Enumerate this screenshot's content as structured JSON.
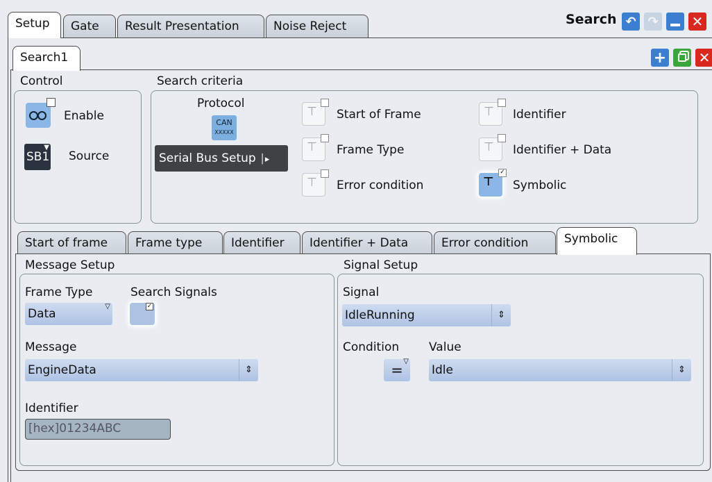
{
  "top_tabs": [
    "Setup",
    "Gate",
    "Result Presentation",
    "Noise Reject"
  ],
  "window": {
    "title": "Search"
  },
  "search_tab": "Search1",
  "control": {
    "title": "Control",
    "enable_label": "Enable",
    "source_badge": "SB1",
    "source_label": "Source"
  },
  "criteria": {
    "title": "Search criteria",
    "protocol_label": "Protocol",
    "protocol_icon_top": "CAN",
    "protocol_icon_bottom": "XXXXX",
    "serial_button": "Serial Bus Setup",
    "items": [
      "Start of Frame",
      "Frame Type",
      "Error condition",
      "Identifier",
      "Identifier + Data",
      "Symbolic"
    ]
  },
  "sub_tabs": [
    "Start of frame",
    "Frame type",
    "Identifier",
    "Identifier + Data",
    "Error condition",
    "Symbolic"
  ],
  "message_setup": {
    "title": "Message Setup",
    "frame_type_label": "Frame Type",
    "frame_type_value": "Data",
    "search_signals_label": "Search Signals",
    "message_label": "Message",
    "message_value": "EngineData",
    "identifier_label": "Identifier",
    "identifier_value": "[hex]01234ABC"
  },
  "signal_setup": {
    "title": "Signal Setup",
    "signal_label": "Signal",
    "signal_value": "IdleRunning",
    "condition_label": "Condition",
    "condition_value": "=",
    "value_label": "Value",
    "value_value": "Idle"
  },
  "colors": {
    "accent_blue": "#3c7fd0",
    "close_red": "#d9281e",
    "add_green": "#3aa53a"
  }
}
